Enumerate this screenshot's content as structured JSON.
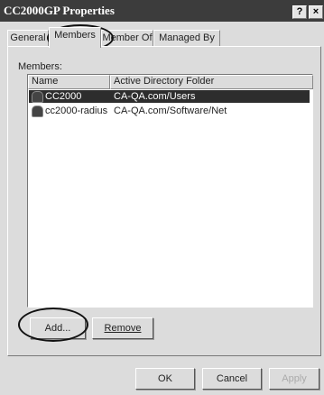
{
  "window": {
    "title": "CC2000GP Properties",
    "help_label": "?",
    "close_label": "×"
  },
  "tabs": [
    {
      "label": "General"
    },
    {
      "label": "Members"
    },
    {
      "label": "Member Of"
    },
    {
      "label": "Managed By"
    }
  ],
  "members_panel": {
    "label": "Members:",
    "columns": [
      {
        "label": "Name"
      },
      {
        "label": "Active Directory Folder"
      }
    ],
    "rows": [
      {
        "name": "CC2000",
        "folder": "CA-QA.com/Users",
        "selected": true,
        "icon": "user-icon"
      },
      {
        "name": "cc2000-radius",
        "folder": "CA-QA.com/Software/Net",
        "selected": false,
        "icon": "user-icon"
      }
    ]
  },
  "buttons": {
    "add": "Add...",
    "remove": "Remove",
    "ok": "OK",
    "cancel": "Cancel",
    "apply": "Apply"
  }
}
